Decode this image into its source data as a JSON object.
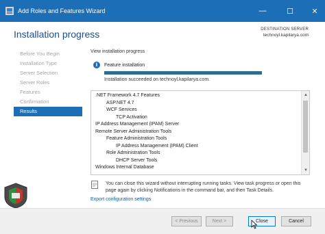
{
  "window": {
    "title": "Add Roles and Features Wizard",
    "controls": {
      "minimize": "—",
      "maximize": "☐",
      "close": "✕"
    }
  },
  "header": {
    "page_title": "Installation progress",
    "destination_label": "DESTINATION SERVER",
    "destination_server": "technoyl.kapilarya.com"
  },
  "sidebar": {
    "items": [
      {
        "label": "Before You Begin",
        "state": "disabled"
      },
      {
        "label": "Installation Type",
        "state": "disabled"
      },
      {
        "label": "Server Selection",
        "state": "disabled"
      },
      {
        "label": "Server Roles",
        "state": "disabled"
      },
      {
        "label": "Features",
        "state": "disabled"
      },
      {
        "label": "Confirmation",
        "state": "disabled"
      },
      {
        "label": "Results",
        "state": "active"
      }
    ]
  },
  "main": {
    "view_label": "View installation progress",
    "info_icon_glyph": "i",
    "feature_label": "Feature installation",
    "progress_fraction": 1.0,
    "success_text": "Installation succeeded on technoyl.kapilarya.com.",
    "results": [
      {
        "text": ".NET Framework 4.7 Features",
        "level": 0
      },
      {
        "text": "ASP.NET 4.7",
        "level": 1
      },
      {
        "text": "WCF Services",
        "level": 1
      },
      {
        "text": "TCP Activation",
        "level": 2
      },
      {
        "text": "IP Address Management (IPAM) Server",
        "level": 0
      },
      {
        "text": "Remote Server Administration Tools",
        "level": 0
      },
      {
        "text": "Feature Administration Tools",
        "level": 1
      },
      {
        "text": "IP Address Management (IPAM) Client",
        "level": 2
      },
      {
        "text": "Role Administration Tools",
        "level": 1
      },
      {
        "text": "DHCP Server Tools",
        "level": 2
      },
      {
        "text": "Windows Internal Database",
        "level": 0
      }
    ],
    "note_text": "You can close this wizard without interrupting running tasks. View task progress or open this page again by clicking Notifications in the command bar, and then Task Details.",
    "export_link": "Export configuration settings"
  },
  "footer": {
    "previous": "< Previous",
    "next": "Next >",
    "close": "Close",
    "cancel": "Cancel"
  },
  "colors": {
    "titlebar": "#1c6fb7",
    "accent": "#1c6fb7",
    "progress": "#2d6d8f",
    "link": "#0b5cad"
  }
}
